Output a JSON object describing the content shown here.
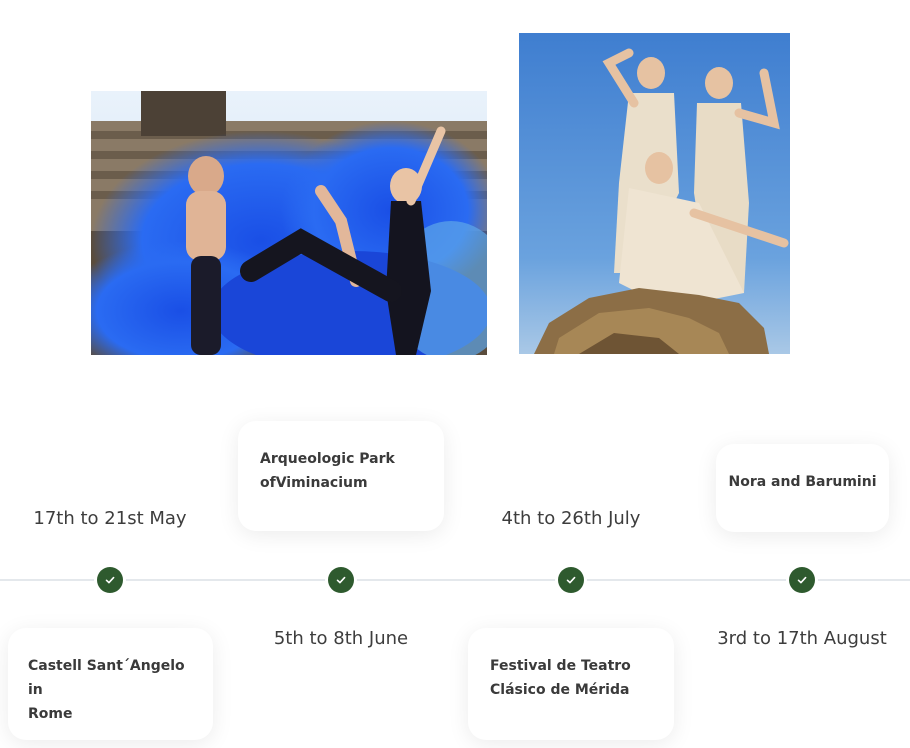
{
  "timeline": {
    "events": [
      {
        "date": "17th to 21st May",
        "venue_line1": "Castell Sant´Angelo in",
        "venue_line2": "Rome"
      },
      {
        "date": "5th to 8th June",
        "venue_line1": "Arqueologic Park",
        "venue_line2": "ofViminacium"
      },
      {
        "date": "4th to 26th July",
        "venue_line1": "Festival de Teatro",
        "venue_line2": "Clásico de Mérida"
      },
      {
        "date": "3rd to 17th August",
        "venue_line1": "Nora and Barumini",
        "venue_line2": ""
      }
    ]
  },
  "colors": {
    "marker": "#2e5a2e",
    "line": "#e4e8ec",
    "smoke": "#1e5cf0",
    "sky": "#4a88d6"
  },
  "icons": {
    "marker": "check-icon"
  }
}
